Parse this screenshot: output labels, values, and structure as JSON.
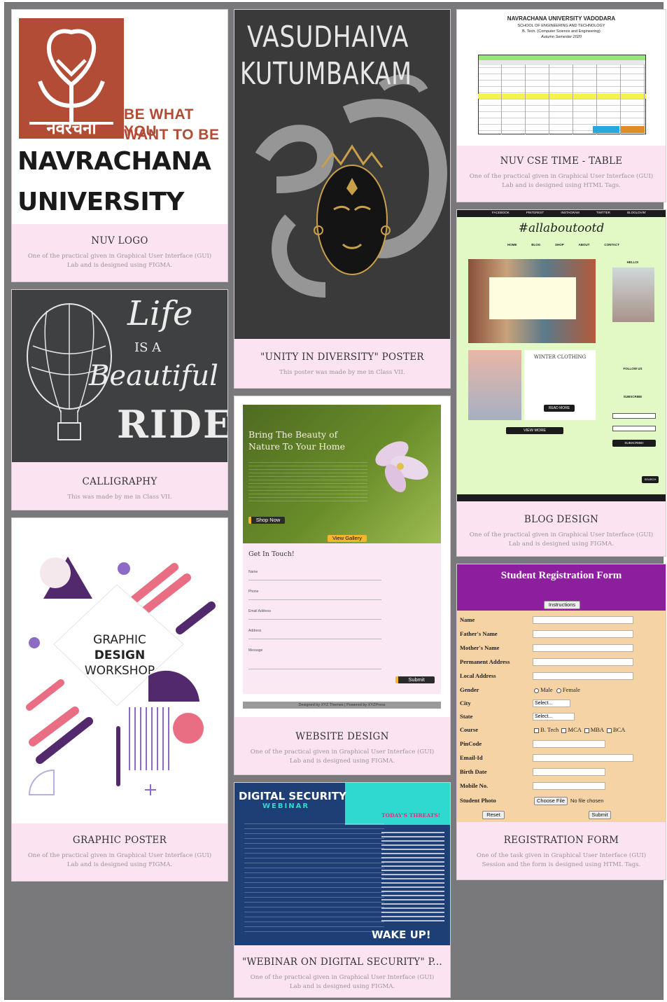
{
  "cards": {
    "nuv_logo": {
      "title": "NUV LOGO",
      "desc": "One of the practical given in Graphical User Interface (GUI) Lab and is designed using FIGMA.",
      "logo_script": "नवरचना",
      "tagline_1": "BE WHAT YOU",
      "tagline_2": "WANT TO BE",
      "name_1": "NAVRACHANA",
      "name_2": "UNIVERSITY"
    },
    "calligraphy": {
      "title": "CALLIGRAPHY",
      "desc": "This was made by me in Class VII.",
      "art_1": "Life",
      "art_2": "IS A",
      "art_3": "Beautiful",
      "art_4": "RIDE"
    },
    "graphic_poster": {
      "title": "GRAPHIC POSTER",
      "desc": "One of the practical given in Graphical User Interface (GUI) Lab and is designed using FIGMA.",
      "poster_1": "GRAPHIC",
      "poster_2": "DESIGN",
      "poster_3": "WORKSHOP"
    },
    "unity_poster": {
      "title": "\"UNITY IN DIVERSITY\" POSTER",
      "desc": "This poster was made by me in Class VII.",
      "art_1": "VASUDHAIVA",
      "art_2": "KUTUMBAKAM"
    },
    "website_design": {
      "title": "WEBSITE DESIGN",
      "desc": "One of the practical given in Graphical User Interface (GUI) Lab and is designed using FIGMA.",
      "hero": "Bring The Beauty of Nature To Your Home",
      "shop_btn": "Shop Now",
      "gallery_btn": "View Gallery",
      "contact_title": "Get In Touch!",
      "fields": [
        "Name",
        "Phone",
        "Email Address",
        "Address",
        "Message"
      ],
      "submit": "Submit",
      "footer": "Designed by XYZ Themes | Powered by XYZPress"
    },
    "webinar": {
      "title": "\"WEBINAR ON DIGITAL SECURITY\" P...",
      "desc": "One of the practical given in Graphical User Interface (GUI) Lab and is designed using FIGMA.",
      "head": "DIGITAL SECURITY",
      "sub": "WEBINAR",
      "threat": "TODAY'S THREATS!",
      "wake": "WAKE UP!"
    },
    "timetable": {
      "title": "NUV CSE TIME - TABLE",
      "desc": "One of the practical given in Graphical User Interface (GUI) Lab and is designed using HTML Tags.",
      "head_1": "NAVRACHANA UNIVERSITY VADODARA",
      "head_2": "SCHOOL OF ENGINEERING AND TECHNOLOGY",
      "head_3": "B. Tech. (Computer Science and Engineering)",
      "head_4": "Autumn Semester 2020"
    },
    "blog": {
      "title": "BLOG DESIGN",
      "desc": "One of the practical given in Graphical User Interface (GUI) Lab and is designed using FIGMA.",
      "brand": "#allaboutootd",
      "nav": [
        "FACEBOOK",
        "PINTEREST",
        "INSTAGRAM",
        "TWITTER",
        "BLOGLOVIN'"
      ],
      "menu": [
        "HOME",
        "BLOG",
        "SHOP",
        "ABOUT",
        "CONTACT"
      ],
      "hello": "HELLO!",
      "winter": "WINTER CLOTHING",
      "read_more": "READ MORE",
      "view_more": "VIEW MORE",
      "follow": "FOLLOW US",
      "subscribe": "SUBSCRIBE",
      "subscribe_btn": "SUBSCRIBE!",
      "search": "SEARCH"
    },
    "registration": {
      "title": "REGISTRATION FORM",
      "desc": "One of the task given in Graphical User Interface (GUI) Session and the form is designed using HTML Tags.",
      "form_title": "Student Registration Form",
      "instructions": "Instructions",
      "labels": [
        "Name",
        "Father's Name",
        "Mother's Name",
        "Permanent Address",
        "Local Address",
        "Gender",
        "City",
        "State",
        "Course",
        "PinCode",
        "Email-Id",
        "Birth Date",
        "Mobile No.",
        "Student Photo"
      ],
      "gender_opts": [
        "Male",
        "Female"
      ],
      "select": "Select...",
      "course_opts": [
        "B. Tech",
        "MCA",
        "MBA",
        "BCA"
      ],
      "choose_file": "Choose File",
      "no_file": "No file chosen",
      "reset": "Reset",
      "submit": "Submit"
    }
  }
}
